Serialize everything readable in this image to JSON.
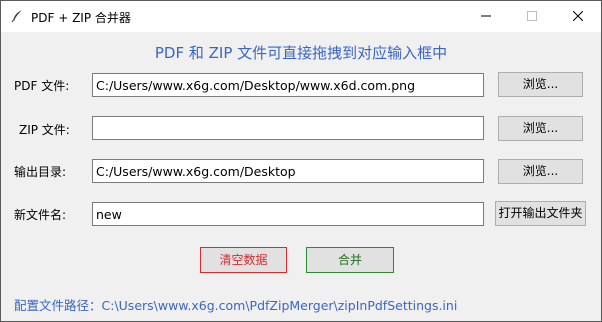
{
  "window": {
    "title": "PDF + ZIP 合并器",
    "controls": {
      "minimize": "minimize-icon",
      "maximize": "maximize-icon",
      "close": "close-icon"
    }
  },
  "heading": "PDF 和 ZIP 文件可直接拖拽到对应输入框中",
  "rows": {
    "pdf": {
      "label": "PDF 文件:",
      "value": "C:/Users/www.x6g.com/Desktop/www.x6d.com.png",
      "button": "浏览..."
    },
    "zip": {
      "label": "ZIP 文件:",
      "value": "",
      "button": "浏览..."
    },
    "output": {
      "label": "输出目录:",
      "value": "C:/Users/www.x6g.com/Desktop",
      "button": "浏览..."
    },
    "newname": {
      "label": "新文件名:",
      "value": "new",
      "button": "打开输出文件夹"
    }
  },
  "actions": {
    "clear": "清空数据",
    "merge": "合并"
  },
  "config_path": "配置文件路径：C:\\Users\\www.x6g.com\\PdfZipMerger\\zipInPdfSettings.ini",
  "colors": {
    "accent": "#3a66c4",
    "clear": "#d72c2c",
    "merge": "#2f8a2f"
  }
}
